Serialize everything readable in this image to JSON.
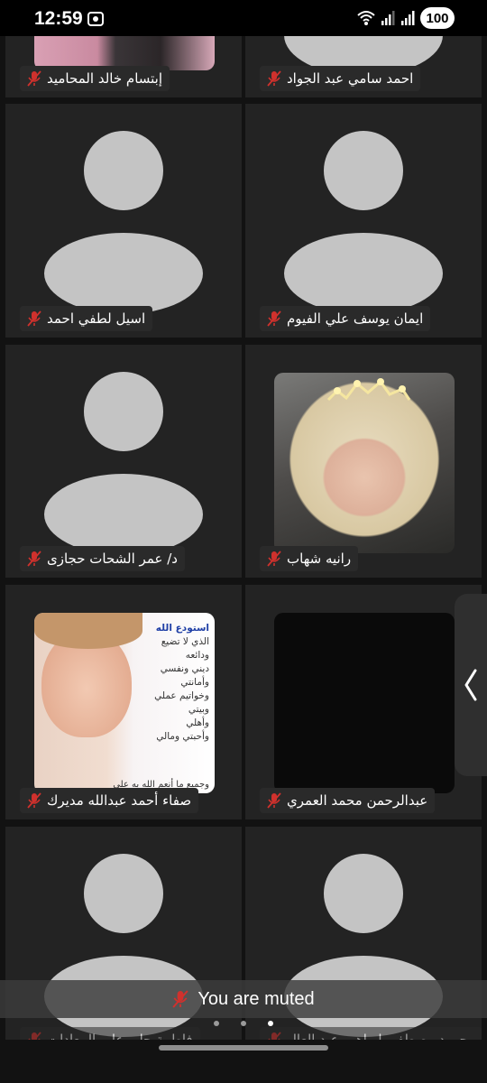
{
  "status_bar": {
    "time": "12:59",
    "battery": "100",
    "icons": [
      "screen-record-icon",
      "wifi-icon",
      "signal-icon",
      "signal-icon"
    ]
  },
  "participants": [
    {
      "name": "إبتسام خالد المحاميد",
      "muted": true,
      "avatar": "photo"
    },
    {
      "name": "احمد سامي عبد الجواد",
      "muted": true,
      "avatar": "placeholder"
    },
    {
      "name": "اسيل لطفي احمد",
      "muted": true,
      "avatar": "placeholder"
    },
    {
      "name": "ايمان يوسف علي  الفيوم",
      "muted": true,
      "avatar": "placeholder"
    },
    {
      "name": "د/ عمر الشحات حجازى",
      "muted": true,
      "avatar": "placeholder"
    },
    {
      "name": "رانيه شهاب",
      "muted": true,
      "avatar": "photo"
    },
    {
      "name": "صفاء أحمد عبدالله مديرك",
      "muted": true,
      "avatar": "photo"
    },
    {
      "name": "عبدالرحمن محمد العمري",
      "muted": true,
      "avatar": "black"
    },
    {
      "name": "فاطمة جابر علي المعادات",
      "muted": true,
      "avatar": "placeholder"
    },
    {
      "name": "محمود مصطفى ابراهيم عبد العال",
      "muted": true,
      "avatar": "placeholder"
    }
  ],
  "photo_caption": {
    "heading": "استودع الله",
    "lines": [
      "الذي لا تضيع",
      "ودائعه",
      "ديني ونفسي",
      "وأمانتي",
      "وخواتيم عملي",
      "وبيتي",
      "وأهلي",
      "وأحبتي ومالي",
      "وجميع ما أنعم الله به علي"
    ]
  },
  "toast": {
    "text": "You are muted",
    "icon": "mic-off-icon"
  },
  "pager": {
    "pages": 3,
    "active_index": 2
  },
  "colors": {
    "background": "#121212",
    "tile": "#232323",
    "avatar": "#c4c4c4",
    "muted": "#d0312d"
  }
}
